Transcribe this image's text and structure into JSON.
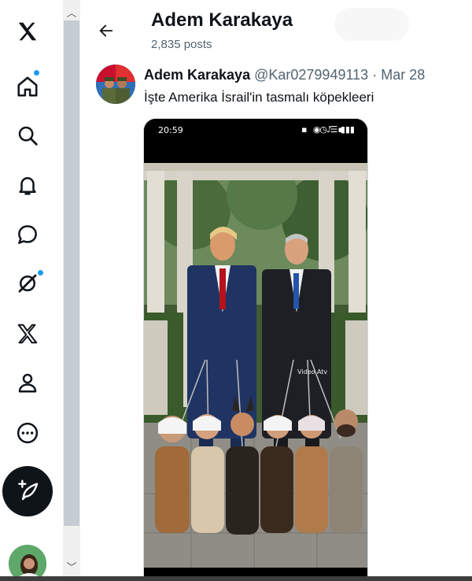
{
  "nav": {
    "items": [
      {
        "icon": "x-logo-icon"
      },
      {
        "icon": "home-icon",
        "has_dot": true
      },
      {
        "icon": "search-icon"
      },
      {
        "icon": "notifications-icon"
      },
      {
        "icon": "messages-icon"
      },
      {
        "icon": "grok-icon",
        "has_dot": true
      },
      {
        "icon": "x-premium-icon"
      },
      {
        "icon": "profile-icon"
      },
      {
        "icon": "more-icon"
      }
    ],
    "compose_icon": "compose-icon",
    "accent_color": "#1d9bf0"
  },
  "header": {
    "title": "Adem Karakaya",
    "post_count": "2,835 posts"
  },
  "tweet": {
    "author_name": "Adem Karakaya",
    "author_handle": "@Kar0279949113",
    "separator": "·",
    "time": "Mar 28",
    "text": "İşte Amerika İsrail'in tasmalı köpekleeri",
    "media": {
      "status_time": "20:59",
      "watermark": "Video Atv"
    }
  }
}
